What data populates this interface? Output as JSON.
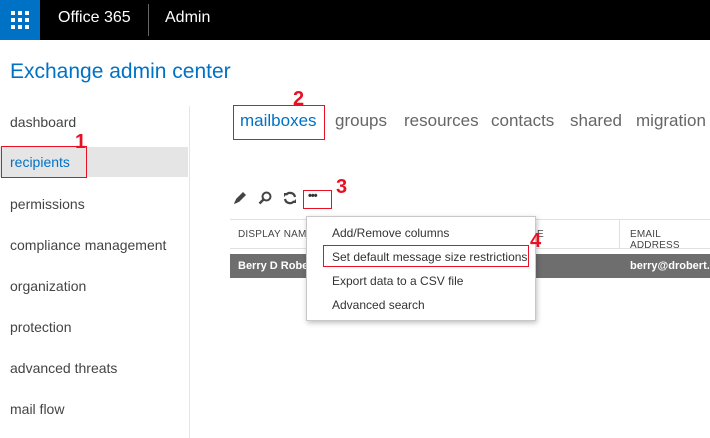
{
  "topbar": {
    "brand": "Office 365",
    "app": "Admin",
    "waffle_icon": "app-launcher-icon"
  },
  "page_title": "Exchange admin center",
  "sidebar": {
    "items": [
      {
        "label": "dashboard",
        "active": false
      },
      {
        "label": "recipients",
        "active": true
      },
      {
        "label": "permissions",
        "active": false
      },
      {
        "label": "compliance management",
        "active": false
      },
      {
        "label": "organization",
        "active": false
      },
      {
        "label": "protection",
        "active": false
      },
      {
        "label": "advanced threats",
        "active": false
      },
      {
        "label": "mail flow",
        "active": false
      }
    ]
  },
  "tabs": [
    {
      "label": "mailboxes",
      "active": true
    },
    {
      "label": "groups"
    },
    {
      "label": "resources"
    },
    {
      "label": "contacts"
    },
    {
      "label": "shared"
    },
    {
      "label": "migration"
    }
  ],
  "toolbar": {
    "icons": [
      "edit-icon",
      "search-icon",
      "refresh-icon",
      "more-options-icon"
    ],
    "more_label": "•••"
  },
  "table": {
    "headers": [
      "DISPLAY NAM",
      "E",
      "EMAIL ADDRESS"
    ],
    "rows": [
      {
        "display_name": "Berry D Robe",
        "email": "berry@drobert."
      }
    ]
  },
  "context_menu": {
    "items": [
      "Add/Remove columns",
      "Set default message size restrictions",
      "Export data to a CSV file",
      "Advanced search"
    ]
  },
  "annotations": {
    "n1": "1",
    "n2": "2",
    "n3": "3",
    "n4": "4"
  },
  "colors": {
    "accent": "#0072c6",
    "annotation": "#e81123",
    "topbar": "#000000"
  }
}
